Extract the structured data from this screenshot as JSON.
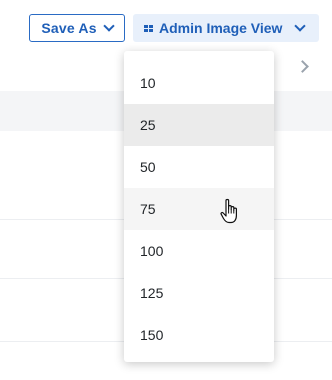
{
  "toolbar": {
    "save_as_label": "Save As",
    "admin_view_label": "Admin Image View",
    "save_as_icon": "chevron-down-icon",
    "admin_view_icon": "grid-view-icon",
    "accent_color": "#1f5fb8"
  },
  "page_size_menu": {
    "options": [
      "10",
      "25",
      "50",
      "75",
      "100",
      "125",
      "150"
    ],
    "highlighted": "25",
    "hovered": "75"
  },
  "pager": {
    "next_icon": "chevron-right-icon"
  }
}
